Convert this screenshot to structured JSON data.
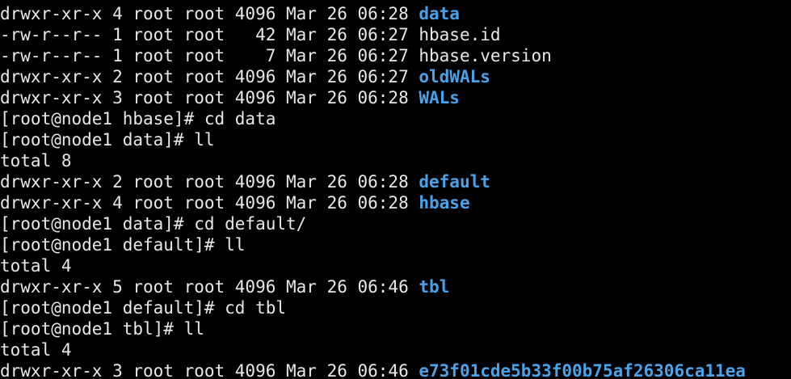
{
  "colors": {
    "background": "#000000",
    "foreground": "#e8e8e8",
    "directory": "#4aa3e8"
  },
  "lines": [
    {
      "kind": "entry",
      "meta": "drwxr-xr-x 4 root root 4096 Mar 26 06:28 ",
      "name": "data",
      "is_dir": true
    },
    {
      "kind": "entry",
      "meta": "-rw-r--r-- 1 root root   42 Mar 26 06:27 ",
      "name": "hbase.id",
      "is_dir": false
    },
    {
      "kind": "entry",
      "meta": "-rw-r--r-- 1 root root    7 Mar 26 06:27 ",
      "name": "hbase.version",
      "is_dir": false
    },
    {
      "kind": "entry",
      "meta": "drwxr-xr-x 2 root root 4096 Mar 26 06:27 ",
      "name": "oldWALs",
      "is_dir": true
    },
    {
      "kind": "entry",
      "meta": "drwxr-xr-x 3 root root 4096 Mar 26 06:28 ",
      "name": "WALs",
      "is_dir": true
    },
    {
      "kind": "prompt",
      "text": "[root@node1 hbase]# cd data"
    },
    {
      "kind": "prompt",
      "text": "[root@node1 data]# ll"
    },
    {
      "kind": "text",
      "text": "total 8"
    },
    {
      "kind": "entry",
      "meta": "drwxr-xr-x 2 root root 4096 Mar 26 06:28 ",
      "name": "default",
      "is_dir": true
    },
    {
      "kind": "entry",
      "meta": "drwxr-xr-x 4 root root 4096 Mar 26 06:28 ",
      "name": "hbase",
      "is_dir": true
    },
    {
      "kind": "prompt",
      "text": "[root@node1 data]# cd default/"
    },
    {
      "kind": "prompt",
      "text": "[root@node1 default]# ll"
    },
    {
      "kind": "text",
      "text": "total 4"
    },
    {
      "kind": "entry",
      "meta": "drwxr-xr-x 5 root root 4096 Mar 26 06:46 ",
      "name": "tbl",
      "is_dir": true
    },
    {
      "kind": "prompt",
      "text": "[root@node1 default]# cd tbl"
    },
    {
      "kind": "prompt",
      "text": "[root@node1 tbl]# ll"
    },
    {
      "kind": "text",
      "text": "total 4"
    },
    {
      "kind": "entry",
      "meta": "drwxr-xr-x 3 root root 4096 Mar 26 06:46 ",
      "name": "e73f01cde5b33f00b75af26306ca11ea",
      "is_dir": true
    }
  ]
}
